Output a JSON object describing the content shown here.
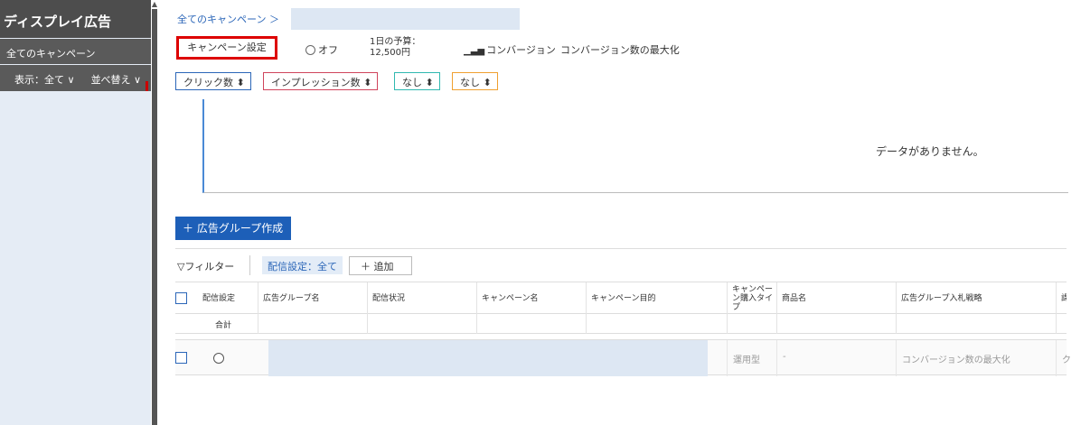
{
  "sidebar": {
    "title": "ディスプレイ広告",
    "all_campaigns": "全てのキャンペーン",
    "show_filter": "表示：全て ∨",
    "sort": "並べ替え ∨"
  },
  "breadcrumb": {
    "root": "全てのキャンペーン",
    "separator": "＞"
  },
  "campaign": {
    "settings_button": "キャンペーン設定",
    "status": "オフ",
    "budget_label": "1日の予算：",
    "budget_value": "12,500円",
    "goal_label": "コンバージョン",
    "goal_value": "コンバージョン数の最大化"
  },
  "metrics": [
    {
      "label": "クリック数 ⬍",
      "color": "#2b66b8"
    },
    {
      "label": "インプレッション数 ⬍",
      "color": "#d0445c"
    },
    {
      "label": "なし ⬍",
      "color": "#30b8b0"
    },
    {
      "label": "なし ⬍",
      "color": "#f0a030"
    }
  ],
  "chart": {
    "empty_message": "データがありません。"
  },
  "create_button": "＋ 広告グループ作成",
  "filters": {
    "filter_label": "▽フィルター",
    "chip": "配信設定：全て",
    "add": "＋ 追加"
  },
  "table": {
    "headers": [
      "配信設定",
      "広告グループ名",
      "配信状況",
      "キャンペーン名",
      "キャンペーン目的",
      "キャンペーン購入タイプ",
      "商品名",
      "広告グループ入札戦略",
      "課"
    ],
    "summary_label": "合計",
    "row": {
      "buy_type": "運用型",
      "product": "-",
      "bid_strategy": "コンバージョン数の最大化",
      "last": "ク"
    }
  }
}
